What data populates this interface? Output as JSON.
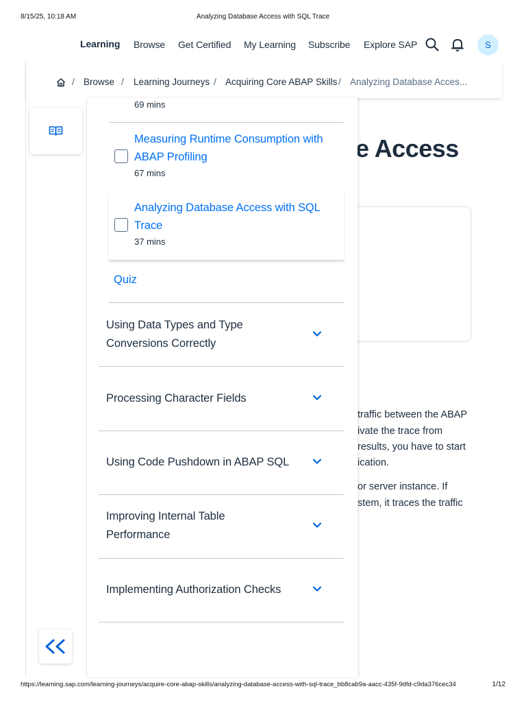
{
  "print": {
    "date": "8/15/25, 10:18 AM",
    "title": "Analyzing Database Access with SQL Trace",
    "url": "https://learning.sap.com/learning-journeys/acquire-core-abap-skills/analyzing-database-access-with-sql-trace_bb8cab9a-aacc-435f-9dfd-c9da376cec34",
    "page": "1/12"
  },
  "nav": {
    "items": [
      "Learning",
      "Browse",
      "Get Certified",
      "My Learning",
      "Subscribe",
      "Explore SAP"
    ],
    "avatar": "S",
    "icons": [
      "search-icon",
      "bell-icon"
    ]
  },
  "breadcrumb": {
    "home_icon": "home-icon",
    "items": [
      "Browse",
      "Learning Journeys",
      "Acquiring Core ABAP Skills",
      "Analyzing Database Acces..."
    ]
  },
  "rail": {
    "icon": "book-icon",
    "collapse_icon": "double-chevron-left-icon"
  },
  "background": {
    "title_fragment": "e Access",
    "lines": [
      "traffic between the ABAP",
      "ivate the trace from",
      "results, you have to start",
      "ication.",
      "or server instance. If",
      "stem, it traces the traffic"
    ]
  },
  "panel": {
    "partial_duration": "69 mins",
    "lessons": [
      {
        "title": "Measuring Runtime Consumption with ABAP Profiling",
        "duration": "67 mins"
      },
      {
        "title": "Analyzing Database Access with SQL Trace",
        "duration": "37 mins"
      }
    ],
    "quiz": "Quiz",
    "units": [
      "Using Data Types and Type Conversions Correctly",
      "Processing Character Fields",
      "Using Code Pushdown in ABAP SQL",
      "Improving Internal Table Performance",
      "Implementing Authorization Checks"
    ]
  },
  "colors": {
    "link": "#0070f2",
    "text": "#1d2d3e",
    "avatar_bg": "#d1efff"
  }
}
